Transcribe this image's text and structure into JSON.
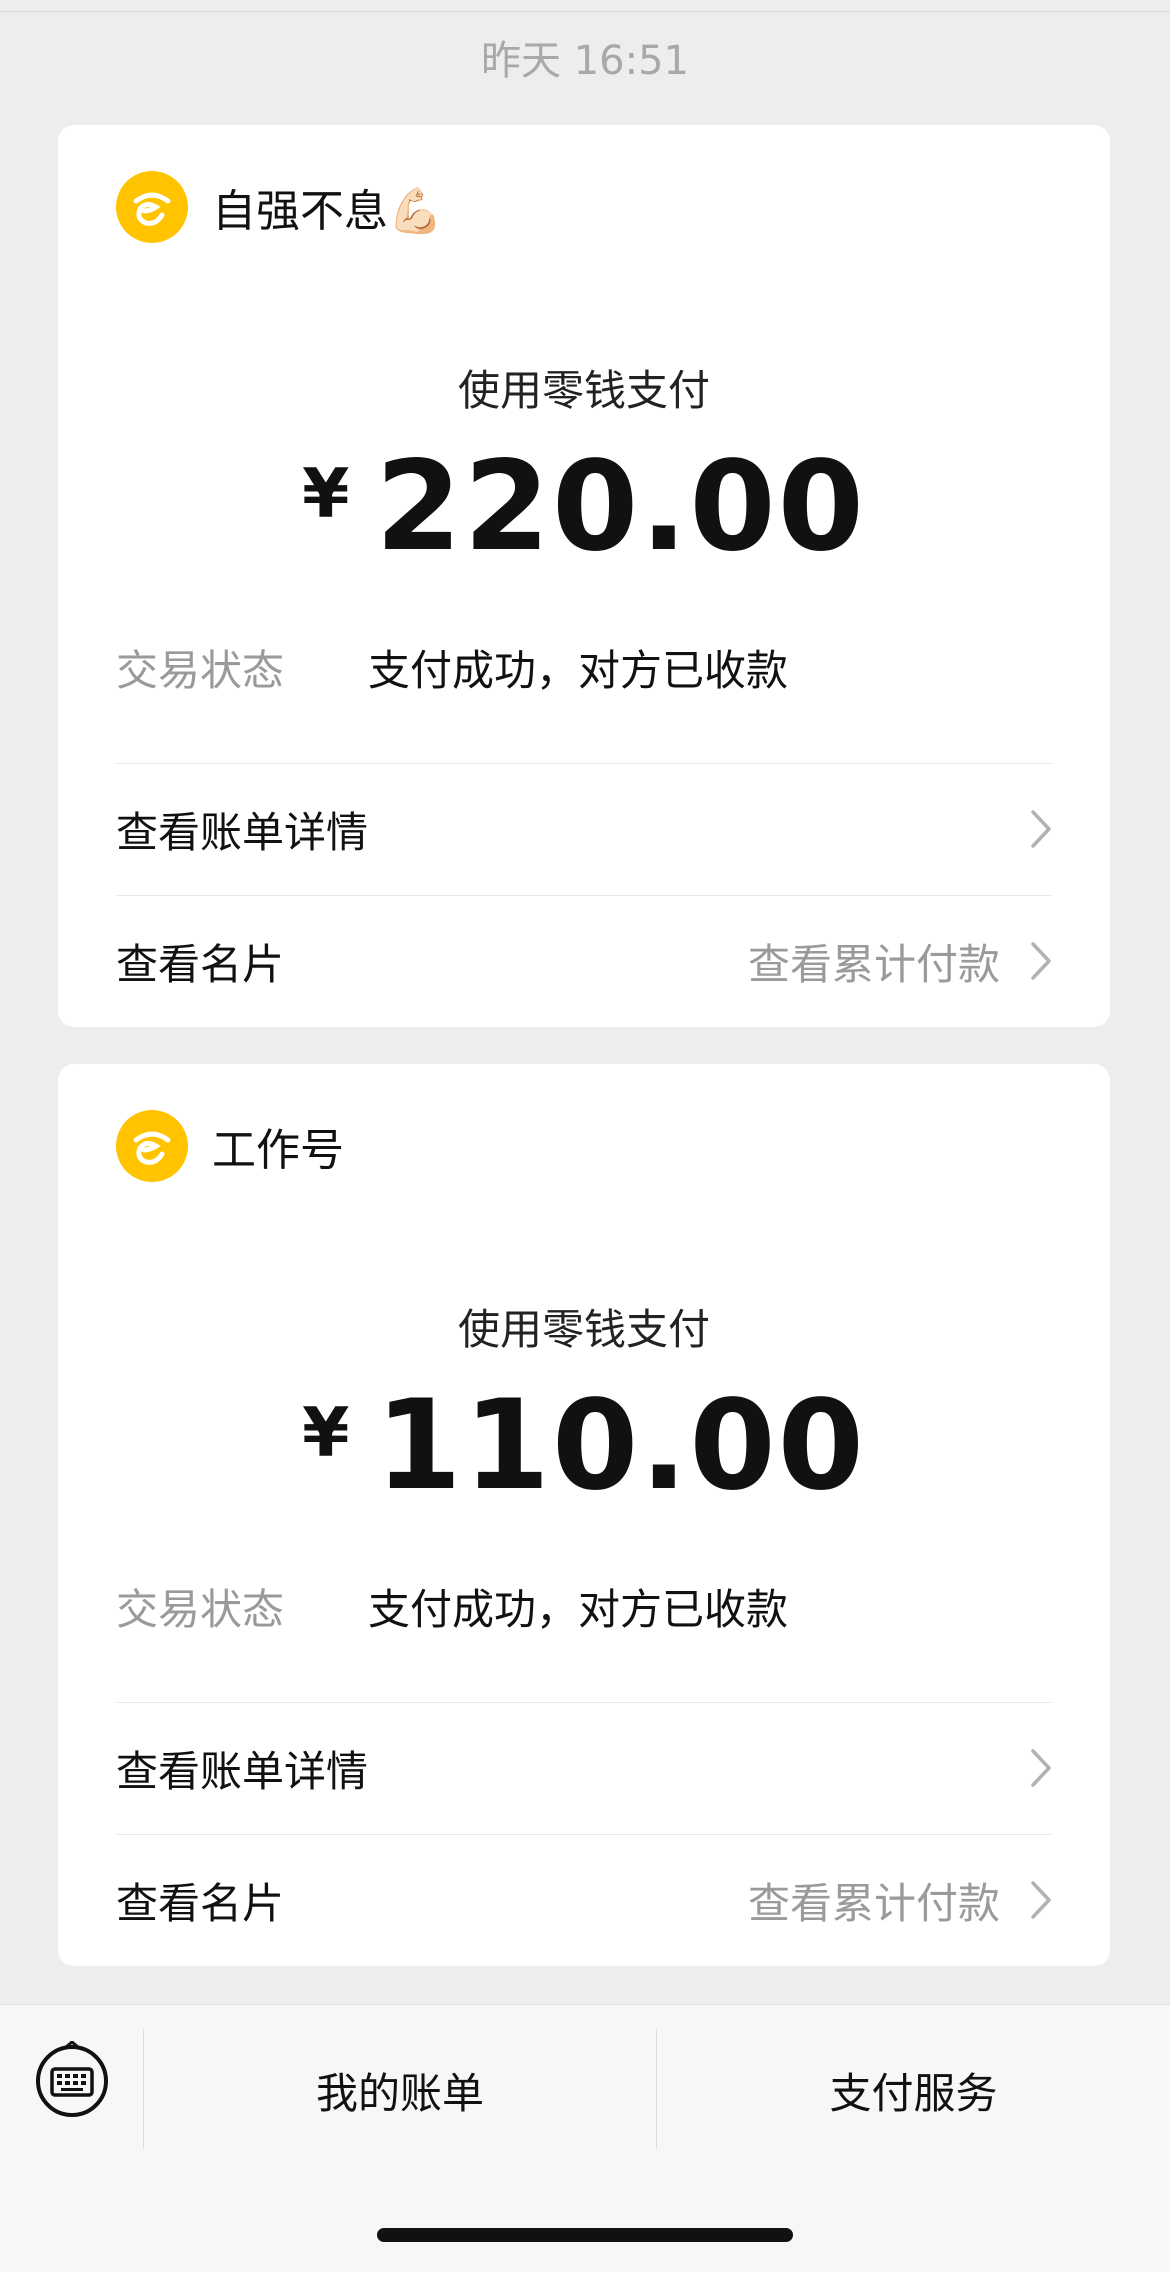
{
  "timestamp": "昨天 16:51",
  "cards": [
    {
      "merchant_name": "自强不息💪🏻",
      "payment_method": "使用零钱支付",
      "currency": "¥",
      "amount": "220.00",
      "status_label": "交易状态",
      "status_value": "支付成功，对方已收款",
      "bill_details_label": "查看账单详情",
      "profile_label": "查看名片",
      "cumulative_label": "查看累计付款"
    },
    {
      "merchant_name": "工作号",
      "payment_method": "使用零钱支付",
      "currency": "¥",
      "amount": "110.00",
      "status_label": "交易状态",
      "status_value": "支付成功，对方已收款",
      "bill_details_label": "查看账单详情",
      "profile_label": "查看名片",
      "cumulative_label": "查看累计付款"
    }
  ],
  "bottom_bar": {
    "keyboard_icon": "keyboard-icon",
    "my_bills_label": "我的账单",
    "payment_services_label": "支付服务"
  },
  "colors": {
    "accent_logo": "#ffc300",
    "background": "#ededed",
    "muted_text": "#9a9a9a"
  }
}
